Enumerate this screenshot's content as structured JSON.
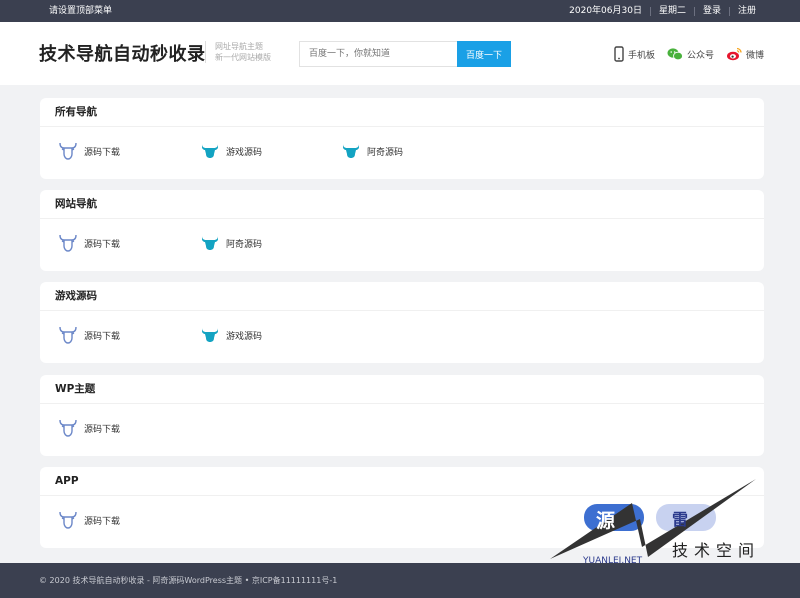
{
  "topbar": {
    "menu": "请设置顶部菜单",
    "date": "2020年06月30日",
    "weekday": "星期二",
    "login": "登录",
    "register": "注册"
  },
  "header": {
    "logo": "技术导航自动秒收录",
    "tagline1": "网址导航主题",
    "tagline2": "新一代网站模版",
    "search_placeholder": "百度一下，你就知道",
    "search_button": "百度一下",
    "links": [
      "手机板",
      "公众号",
      "微博"
    ]
  },
  "sections": [
    {
      "title": "所有导航",
      "links": [
        "源码下载",
        "游戏源码",
        "阿奇源码"
      ]
    },
    {
      "title": "网站导航",
      "links": [
        "源码下载",
        "阿奇源码"
      ]
    },
    {
      "title": "游戏源码",
      "links": [
        "源码下载",
        "游戏源码"
      ]
    },
    {
      "title": "WP主题",
      "links": [
        "源码下载"
      ]
    },
    {
      "title": "APP",
      "links": [
        "源码下载"
      ]
    }
  ],
  "footer": "© 2020 技术导航自动秒收录 - 阿奇源码WordPress主题 • 京ICP备11111111号-1",
  "watermark": {
    "char1": "源",
    "char2": "雷",
    "sub": "技术空间",
    "url": "YUANLEI.NET"
  }
}
